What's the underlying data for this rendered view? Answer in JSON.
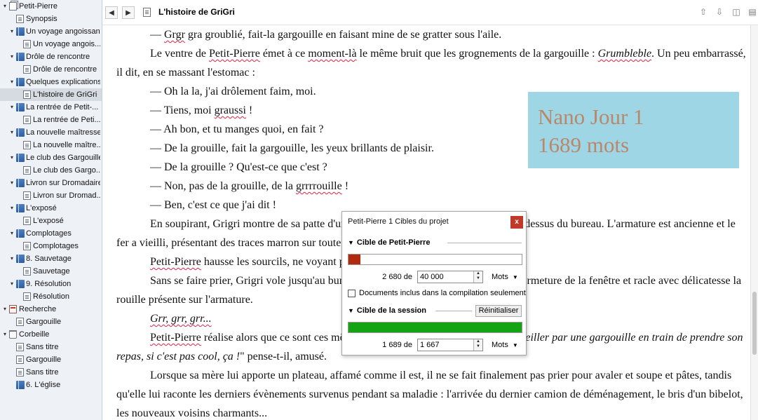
{
  "binder": {
    "items": [
      {
        "label": "Petit-Pierre",
        "icon": "multi-document-icon",
        "arrow": "collapse-arrow-icon",
        "selected": false
      },
      {
        "label": "Synopsis",
        "icon": "document-icon",
        "arrow": "",
        "selected": false
      },
      {
        "label": "Un voyage angoissant",
        "icon": "folder-icon",
        "arrow": "collapse-arrow-icon",
        "selected": false
      },
      {
        "label": "Un voyage angois...",
        "icon": "document-icon",
        "arrow": "",
        "selected": false
      },
      {
        "label": "Drôle de rencontre",
        "icon": "folder-icon",
        "arrow": "collapse-arrow-icon",
        "selected": false
      },
      {
        "label": "Drôle de rencontre",
        "icon": "document-icon",
        "arrow": "",
        "selected": false
      },
      {
        "label": "Quelques explications",
        "icon": "folder-icon",
        "arrow": "collapse-arrow-icon",
        "selected": false
      },
      {
        "label": "L'histoire de GriGri",
        "icon": "document-icon",
        "arrow": "",
        "selected": true
      },
      {
        "label": "La rentrée de Petit-...",
        "icon": "folder-icon",
        "arrow": "collapse-arrow-icon",
        "selected": false
      },
      {
        "label": "La rentrée de Peti...",
        "icon": "document-icon",
        "arrow": "",
        "selected": false
      },
      {
        "label": "La nouvelle maîtresse",
        "icon": "folder-icon",
        "arrow": "collapse-arrow-icon",
        "selected": false
      },
      {
        "label": "La nouvelle maître...",
        "icon": "document-icon",
        "arrow": "",
        "selected": false
      },
      {
        "label": "Le club des Gargouilles",
        "icon": "folder-icon",
        "arrow": "collapse-arrow-icon",
        "selected": false
      },
      {
        "label": "Le club des Gargo...",
        "icon": "document-icon",
        "arrow": "",
        "selected": false
      },
      {
        "label": "Livron sur Dromadaire",
        "icon": "folder-icon",
        "arrow": "collapse-arrow-icon",
        "selected": false
      },
      {
        "label": "Livron sur Dromad...",
        "icon": "document-icon",
        "arrow": "",
        "selected": false
      },
      {
        "label": "L'exposé",
        "icon": "folder-icon",
        "arrow": "collapse-arrow-icon",
        "selected": false
      },
      {
        "label": "L'exposé",
        "icon": "document-icon",
        "arrow": "",
        "selected": false
      },
      {
        "label": "Complotages",
        "icon": "folder-icon",
        "arrow": "collapse-arrow-icon",
        "selected": false
      },
      {
        "label": "Complotages",
        "icon": "document-icon",
        "arrow": "",
        "selected": false
      },
      {
        "label": "8. Sauvetage",
        "icon": "folder-icon",
        "arrow": "collapse-arrow-icon",
        "selected": false
      },
      {
        "label": "Sauvetage",
        "icon": "document-icon",
        "arrow": "",
        "selected": false
      },
      {
        "label": "9. Résolution",
        "icon": "folder-icon",
        "arrow": "collapse-arrow-icon",
        "selected": false
      },
      {
        "label": "Résolution",
        "icon": "document-icon",
        "arrow": "",
        "selected": false
      },
      {
        "label": "Recherche",
        "icon": "research-icon",
        "arrow": "collapse-arrow-icon",
        "selected": false
      },
      {
        "label": "Gargouille",
        "icon": "document-icon",
        "arrow": "",
        "selected": false
      },
      {
        "label": "Corbeille",
        "icon": "trash-icon",
        "arrow": "collapse-arrow-icon",
        "selected": false
      },
      {
        "label": "Sans titre",
        "icon": "document-icon",
        "arrow": "",
        "selected": false
      },
      {
        "label": "Gargouille",
        "icon": "document-icon",
        "arrow": "",
        "selected": false
      },
      {
        "label": "Sans titre",
        "icon": "document-icon",
        "arrow": "",
        "selected": false
      },
      {
        "label": "6. L'église",
        "icon": "folder-icon",
        "arrow": "",
        "selected": false
      }
    ]
  },
  "header": {
    "back_glyph": "◀",
    "forward_glyph": "▶",
    "title": "L'histoire de GriGri",
    "icons": [
      "arrow-up-icon",
      "arrow-down-icon",
      "split-view-icon",
      "split-horizontal-icon"
    ]
  },
  "editor": {
    "paragraphs": [
      {
        "parts": [
          {
            "t": "— "
          },
          {
            "t": "Grgr",
            "sq": true
          },
          {
            "t": " gra groublié, fait-la gargouille en faisant mine de se gratter sous l'aile."
          }
        ]
      },
      {
        "parts": [
          {
            "t": "Le ventre de "
          },
          {
            "t": "Petit-Pierre",
            "sq": true
          },
          {
            "t": " émet à ce "
          },
          {
            "t": "moment-là",
            "sq": true
          },
          {
            "t": " le même bruit que les grognements de la gargouille : "
          },
          {
            "t": "Grumbleble",
            "i": true,
            "sq": true
          },
          {
            "t": ". Un peu embarrassé, il dit, en se massant l'estomac :"
          }
        ]
      },
      {
        "parts": [
          {
            "t": "— Oh la la, j'ai drôlement faim, moi."
          }
        ]
      },
      {
        "parts": [
          {
            "t": "— Tiens, moi "
          },
          {
            "t": "graussi",
            "sq": true
          },
          {
            "t": " !"
          }
        ]
      },
      {
        "parts": [
          {
            "t": "— Ah bon, et tu manges quoi, en fait ?"
          }
        ]
      },
      {
        "parts": [
          {
            "t": "— De la grouille, fait la gargouille, les yeux brillants de plaisir."
          }
        ]
      },
      {
        "parts": [
          {
            "t": "— De la grouille ? Qu'est-ce que c'est ?"
          }
        ]
      },
      {
        "parts": [
          {
            "t": "— Non, pas de la grouille, de la "
          },
          {
            "t": "grrrrouille",
            "sq": true
          },
          {
            "t": " !"
          }
        ]
      },
      {
        "parts": [
          {
            "t": "— Ben, c'est ce que j'ai dit !"
          }
        ]
      },
      {
        "parts": [
          {
            "t": "En soupirant, Grigri montre de sa patte d'un air gourmand la grille qui se trouve au-dessus du bureau. L'armature est ancienne et le fer a vieilli, présentant des traces marron sur toute sa surface."
          }
        ]
      },
      {
        "parts": [
          {
            "t": "Petit-Pierre",
            "sq": true
          },
          {
            "t": " hausse les sourcils, ne voyant pas où son ami veut en venir."
          }
        ]
      },
      {
        "parts": [
          {
            "t": "Sans se faire prier, Grigri vole jusqu'au bureau, s'accroche du bout des griffes à la fermeture de la fenêtre et racle avec délicatesse la rouille présente sur l'armature."
          }
        ]
      },
      {
        "parts": [
          {
            "t": "Grr, grr, grr...",
            "i": true,
            "sq": true
          }
        ]
      },
      {
        "parts": [
          {
            "t": "Petit-Pierre",
            "sq": true
          },
          {
            "t": " réalise alors que ce sont ces mêmes bruits qu'il a entendus. \""
          },
          {
            "t": "Se faire réveiller par une gargouille en train de prendre son repas, si c'est pas cool, ça !",
            "i": true
          },
          {
            "t": "\" pense-t-il, amusé."
          }
        ]
      },
      {
        "parts": [
          {
            "t": "Lorsque sa mère lui apporte un plateau, affamé comme il est, il ne se fait finalement pas prier pour avaler et soupe et pâtes, tandis qu'elle lui raconte les derniers évènements survenus pendant sa maladie : l'arrivée du dernier camion de déménagement, le bris d'un bibelot, les nouveaux voisins charmants..."
          }
        ]
      }
    ]
  },
  "overlay": {
    "line1": "Nano Jour 1",
    "line2": "1689 mots"
  },
  "targets": {
    "title": "Petit-Pierre 1 Cibles du projet",
    "close_label": "x",
    "project": {
      "heading": "Cible de Petit-Pierre",
      "count_label": "2 680 de",
      "target_value": "40 000",
      "unit": "Mots",
      "progress": 0.067,
      "color": "#b22a0e"
    },
    "checkbox_label": "Documents inclus dans la compilation seulement",
    "checkbox_checked": false,
    "session": {
      "heading": "Cible de la session",
      "reset_label": "Réinitialiser",
      "count_label": "1 689 de",
      "target_value": "1 667",
      "unit": "Mots",
      "progress": 1.0,
      "color": "#13a313"
    }
  }
}
